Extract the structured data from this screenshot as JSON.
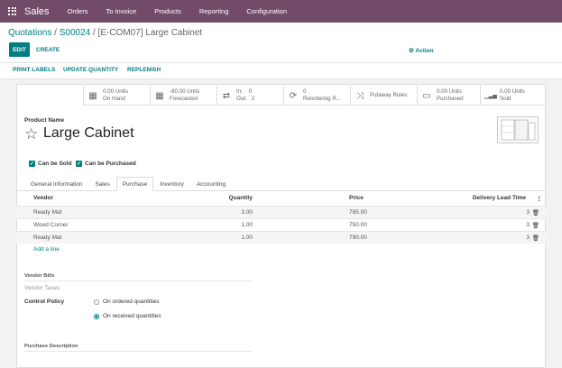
{
  "navbar": {
    "app_name": "Sales",
    "menu": [
      "Orders",
      "To Invoice",
      "Products",
      "Reporting",
      "Configuration"
    ]
  },
  "breadcrumb": {
    "quotations": "Quotations",
    "sep1": " / ",
    "order": "S00024",
    "sep2": " / ",
    "current": "[E-COM07] Large Cabinet"
  },
  "toolbar": {
    "edit_label": "EDIT",
    "create_label": "CREATE",
    "action_label": "Action"
  },
  "statusbar": {
    "print_labels": "PRINT LABELS",
    "update_quantity": "UPDATE QUANTITY",
    "replenish": "REPLENISH"
  },
  "smart_buttons": [
    {
      "icon": "cubes-icon",
      "glyph": "▦",
      "value": "0.00 Units",
      "label": "On Hand"
    },
    {
      "icon": "cubes-icon",
      "glyph": "▦",
      "value": "-80.00 Units",
      "label": "Forecasted"
    },
    {
      "icon": "in-out-arrows-icon",
      "glyph": "⇄",
      "value": "In:    0",
      "label": "Out:   2"
    },
    {
      "icon": "refresh-icon",
      "glyph": "⟳",
      "value": "0",
      "label": "Reordering R..."
    },
    {
      "icon": "shuffle-icon",
      "glyph": "⤨",
      "value": "Putaway Rules",
      "label": ""
    },
    {
      "icon": "credit-card-icon",
      "glyph": "▭",
      "value": "0.00 Units",
      "label": "Purchased"
    },
    {
      "icon": "signal-icon",
      "glyph": "▁▃▅",
      "value": "0.00 Units",
      "label": "Sold"
    }
  ],
  "product": {
    "name_label": "Product Name",
    "name": "Large Cabinet",
    "can_be_sold": "Can be Sold",
    "can_be_purchased": "Can be Purchased"
  },
  "tabs": [
    "General Information",
    "Sales",
    "Purchase",
    "Inventory",
    "Accounting"
  ],
  "active_tab": "Purchase",
  "vendor_table": {
    "headers": {
      "vendor": "Vendor",
      "quantity": "Quantity",
      "price": "Price",
      "lead_time": "Delivery Lead Time"
    },
    "rows": [
      {
        "vendor": "Ready Mat",
        "quantity": "3.00",
        "price": "785.00",
        "lead_time": "3"
      },
      {
        "vendor": "Wood Corner",
        "quantity": "1.00",
        "price": "750.00",
        "lead_time": "3"
      },
      {
        "vendor": "Ready Mat",
        "quantity": "1.00",
        "price": "790.00",
        "lead_time": "3"
      }
    ],
    "add_line": "Add a line"
  },
  "vendor_bills": {
    "section_title": "Vendor Bills",
    "vendor_taxes_label": "Vendor Taxes",
    "control_policy_label": "Control Policy",
    "options": [
      "On ordered quantities",
      "On received quantities"
    ],
    "selected": "On received quantities"
  },
  "purchase_description": {
    "section_title": "Purchase Description"
  },
  "colors": {
    "navbar": "#714b67",
    "accent": "#017e84"
  }
}
